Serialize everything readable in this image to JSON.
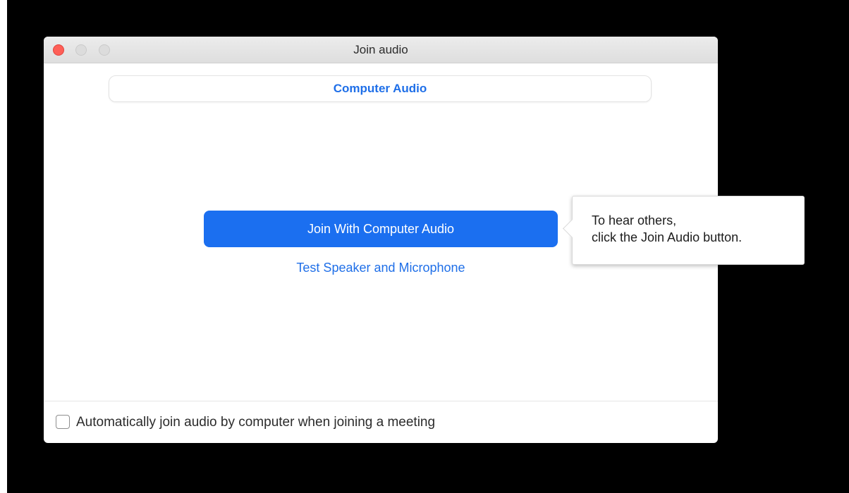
{
  "window": {
    "title": "Join audio"
  },
  "tabs": {
    "computer_audio": "Computer Audio"
  },
  "main": {
    "join_button_label": "Join With Computer Audio",
    "test_link_label": "Test Speaker and Microphone"
  },
  "tooltip": {
    "line1": "To hear others,",
    "line2": "click the Join Audio button."
  },
  "footer": {
    "auto_join_label": "Automatically join audio by computer when joining a meeting",
    "auto_join_checked": false
  },
  "colors": {
    "accent": "#1b6ff0",
    "link": "#1f6fe8",
    "close_light": "#fe5f57",
    "background": "#000000"
  }
}
